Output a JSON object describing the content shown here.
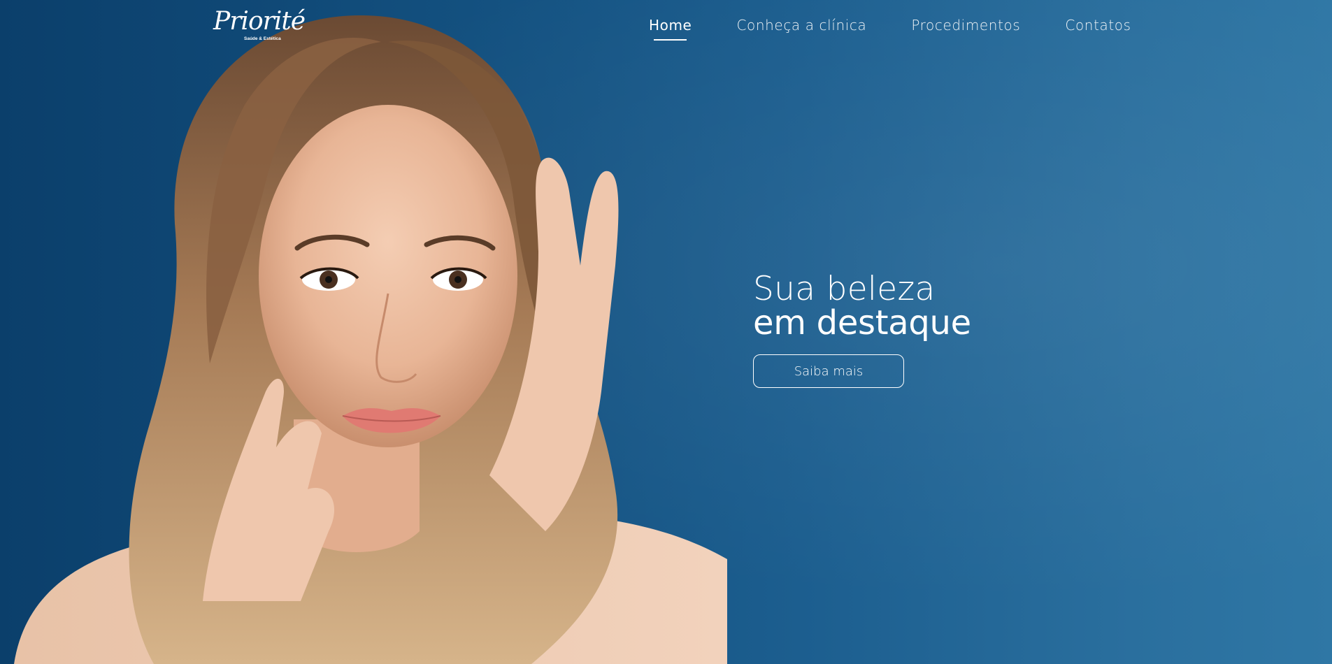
{
  "brand": {
    "logo_text": "Priorité",
    "logo_subtext": "Saúde & Estética"
  },
  "nav": {
    "items": [
      {
        "label": "Home",
        "active": true
      },
      {
        "label": "Conheça a clínica",
        "active": false
      },
      {
        "label": "Procedimentos",
        "active": false
      },
      {
        "label": "Contatos",
        "active": false
      }
    ]
  },
  "hero": {
    "headline_line1": "Sua beleza",
    "headline_line2": "em destaque",
    "cta_label": "Saiba mais"
  },
  "colors": {
    "background_left": "#0b3f6b",
    "background_right": "#2f77a5",
    "text": "#ffffff"
  }
}
